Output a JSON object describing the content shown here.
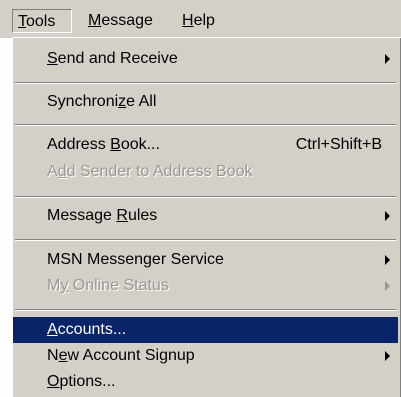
{
  "menubar": {
    "items": [
      {
        "label": "Tools",
        "access_key": "T",
        "rest": "ools"
      },
      {
        "label": "Message",
        "access_key": "M",
        "rest": "essage"
      },
      {
        "label": "Help",
        "access_key": "H",
        "rest": "elp"
      }
    ]
  },
  "menu": {
    "send_receive": {
      "pre": "",
      "key": "S",
      "post": "end and Receive",
      "has_submenu": true
    },
    "synchronize_all": {
      "pre": "Synchroni",
      "key": "z",
      "post": "e All"
    },
    "address_book": {
      "pre": "Address ",
      "key": "B",
      "post": "ook...",
      "shortcut": "Ctrl+Shift+B"
    },
    "add_sender": {
      "pre": "A",
      "key": "d",
      "post": "d Sender to Address Book",
      "enabled": false
    },
    "message_rules": {
      "pre": "Message ",
      "key": "R",
      "post": "ules",
      "has_submenu": true
    },
    "msn_messenger": {
      "pre": "MSN Messenger Service",
      "key": "",
      "post": "",
      "has_submenu": true
    },
    "my_online_status": {
      "pre": "M",
      "key": "y",
      "post": " Online Status",
      "enabled": false,
      "has_submenu": true
    },
    "accounts": {
      "pre": "",
      "key": "A",
      "post": "ccounts...",
      "selected": true
    },
    "new_account_signup": {
      "pre": "N",
      "key": "e",
      "post": "w Account Signup",
      "has_submenu": true
    },
    "options": {
      "pre": "",
      "key": "O",
      "post": "ptions..."
    }
  },
  "colors": {
    "menu_face": "#d4d0c8",
    "highlight": "#0a246a",
    "disabled_text": "#9a9891"
  }
}
